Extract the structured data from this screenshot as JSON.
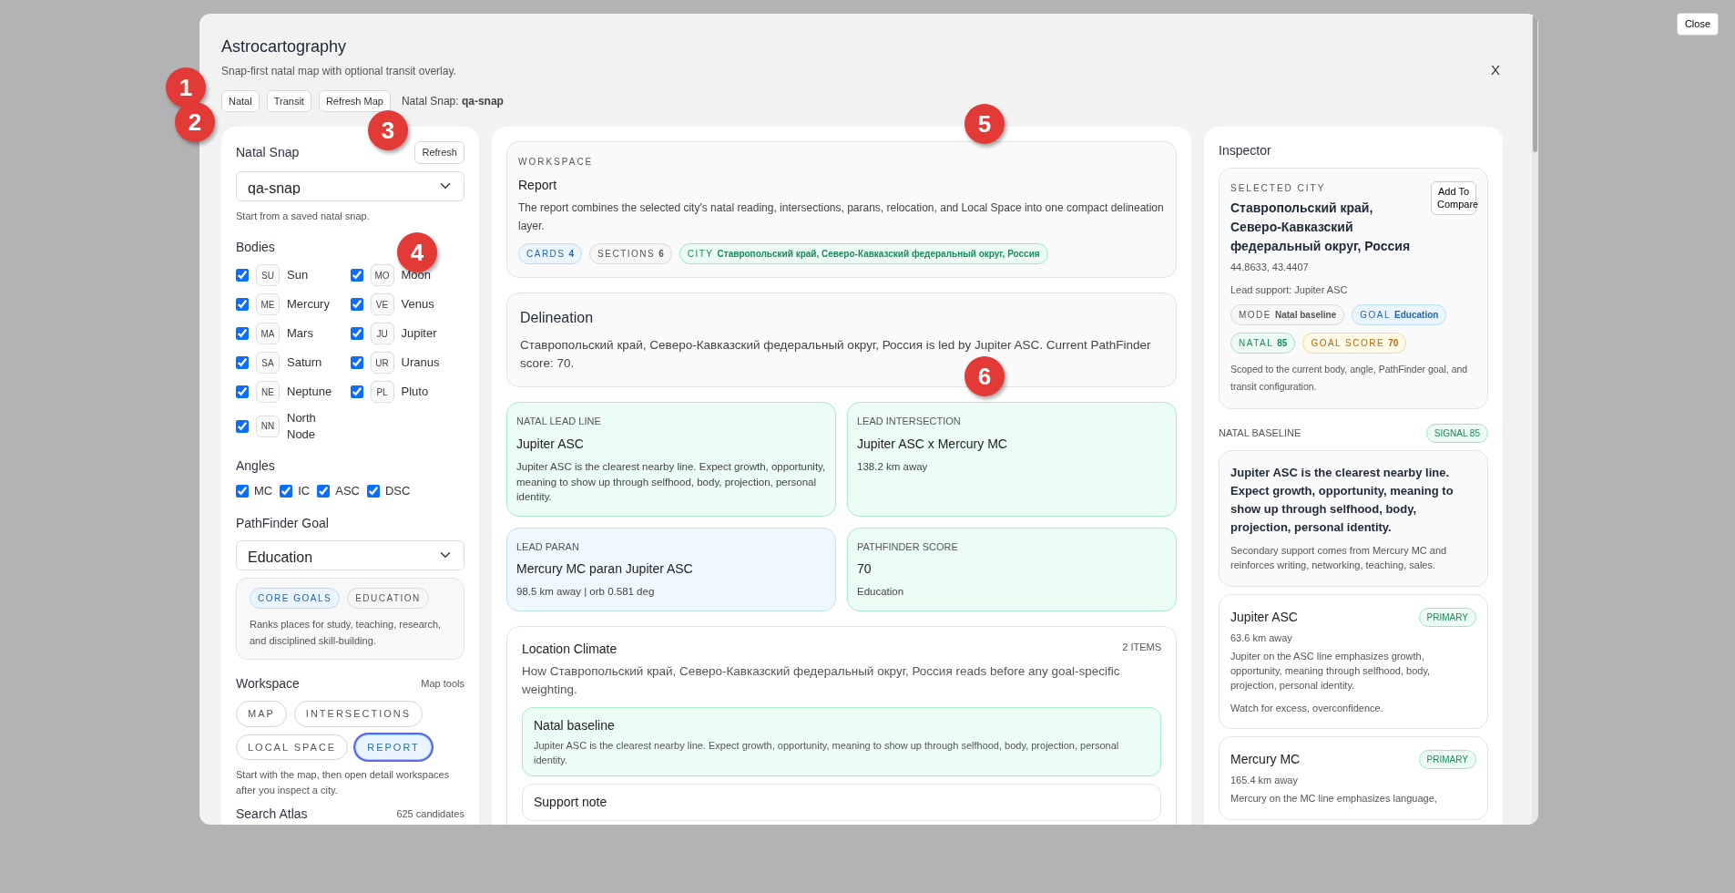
{
  "page": {
    "close_button": "Close"
  },
  "modal": {
    "title": "Astrocartography",
    "subtitle": "Snap-first natal map with optional transit overlay.",
    "close": "X",
    "mode_buttons": [
      "Natal",
      "Transit",
      "Refresh Map"
    ],
    "snap_label": "Natal Snap:",
    "snap_value": "qa-snap"
  },
  "markers": [
    "1",
    "2",
    "3",
    "4",
    "5",
    "6"
  ],
  "left": {
    "snap_title": "Natal Snap",
    "refresh": "Refresh",
    "snap_select": "qa-snap",
    "snap_help": "Start from a saved natal snap.",
    "bodies_title": "Bodies",
    "bodies": [
      {
        "code": "SU",
        "name": "Sun",
        "checked": true
      },
      {
        "code": "MO",
        "name": "Moon",
        "checked": true
      },
      {
        "code": "ME",
        "name": "Mercury",
        "checked": true
      },
      {
        "code": "VE",
        "name": "Venus",
        "checked": true
      },
      {
        "code": "MA",
        "name": "Mars",
        "checked": true
      },
      {
        "code": "JU",
        "name": "Jupiter",
        "checked": true
      },
      {
        "code": "SA",
        "name": "Saturn",
        "checked": true
      },
      {
        "code": "UR",
        "name": "Uranus",
        "checked": true
      },
      {
        "code": "NE",
        "name": "Neptune",
        "checked": true
      },
      {
        "code": "PL",
        "name": "Pluto",
        "checked": true
      },
      {
        "code": "NN",
        "name": "North Node",
        "checked": true
      }
    ],
    "angles_title": "Angles",
    "angles": [
      {
        "name": "MC",
        "checked": true
      },
      {
        "name": "IC",
        "checked": true
      },
      {
        "name": "ASC",
        "checked": true
      },
      {
        "name": "DSC",
        "checked": true
      }
    ],
    "goal_title": "PathFinder Goal",
    "goal_select": "Education",
    "goal_tags": [
      {
        "text": "CORE GOALS",
        "kind": "info"
      },
      {
        "text": "EDUCATION",
        "kind": "neutral"
      }
    ],
    "goal_text": "Ranks places for study, teaching, research, and disciplined skill-building.",
    "workspace_title": "Workspace",
    "workspace_link": "Map tools",
    "workspace_tabs": [
      {
        "label": "MAP",
        "selected": false
      },
      {
        "label": "INTERSECTIONS",
        "selected": false
      },
      {
        "label": "LOCAL SPACE",
        "selected": false
      },
      {
        "label": "REPORT",
        "selected": true
      }
    ],
    "workspace_help": "Start with the map, then open detail workspaces after you inspect a city.",
    "atlas_title": "Search Atlas",
    "atlas_count": "625 candidates"
  },
  "center": {
    "workspace": {
      "eyebrow": "WORKSPACE",
      "title": "Report",
      "text": "The report combines the selected city's natal reading, intersections, parans, relocation, and Local Space into one compact delineation layer.",
      "chips": [
        {
          "label": "CARDS",
          "value": "4",
          "kind": "info"
        },
        {
          "label": "SECTIONS",
          "value": "6",
          "kind": "neutral"
        },
        {
          "label": "CITY",
          "value": "Ставропольский край, Северо-Кавказский федеральный округ, Россия",
          "kind": "success"
        }
      ]
    },
    "delineation": {
      "title": "Delineation",
      "text": "Ставропольский край, Северо-Кавказский федеральный округ, Россия is led by Jupiter ASC. Current PathFinder score: 70."
    },
    "summary_cards": [
      {
        "label": "NATAL LEAD LINE",
        "title": "Jupiter ASC",
        "text": "Jupiter ASC is the clearest nearby line. Expect growth, opportunity, meaning to show up through selfhood, body, projection, personal identity.",
        "kind": "success"
      },
      {
        "label": "LEAD INTERSECTION",
        "title": "Jupiter ASC x Mercury MC",
        "text": "138.2 km away",
        "kind": "success"
      },
      {
        "label": "LEAD PARAN",
        "title": "Mercury MC paran Jupiter ASC",
        "text": "98.5 km away | orb 0.581 deg",
        "kind": "info"
      },
      {
        "label": "PATHFINDER SCORE",
        "title": "70",
        "text": "Education",
        "kind": "success"
      }
    ],
    "climate": {
      "title": "Location Climate",
      "count": "2 ITEMS",
      "text": "How Ставропольский край, Северо-Кавказский федеральный округ, Россия reads before any goal-specific weighting.",
      "items": [
        {
          "title": "Natal baseline",
          "text": "Jupiter ASC is the clearest nearby line. Expect growth, opportunity, meaning to show up through selfhood, body, projection, personal identity.",
          "kind": "success"
        },
        {
          "title": "Support note",
          "kind": "neutral"
        }
      ]
    }
  },
  "inspector": {
    "title": "Inspector",
    "city": {
      "eyebrow": "SELECTED CITY",
      "name": "Ставропольский край, Северо-Кавказский федеральный округ, Россия",
      "compare": "Add To Compare",
      "coords": "44.8633, 43.4407",
      "lead": "Lead support: Jupiter ASC",
      "chips": [
        {
          "label": "MODE",
          "value": "Natal baseline",
          "kind": "neutral"
        },
        {
          "label": "GOAL",
          "value": "Education",
          "kind": "info"
        },
        {
          "label": "NATAL",
          "value": "85",
          "kind": "success"
        },
        {
          "label": "GOAL SCORE",
          "value": "70",
          "kind": "warning"
        }
      ],
      "note": "Scoped to the current body, angle, PathFinder goal, and transit configuration."
    },
    "baseline_label": "NATAL BASELINE",
    "baseline_signal": "SIGNAL 85",
    "baseline": {
      "headline": "Jupiter ASC is the clearest nearby line. Expect growth, opportunity, meaning to show up through selfhood, body, projection, personal identity.",
      "text": "Secondary support comes from Mercury MC and reinforces writing, networking, teaching, sales."
    },
    "lines": [
      {
        "title": "Jupiter ASC",
        "badge": "PRIMARY",
        "distance": "63.6 km away",
        "text": "Jupiter on the ASC line emphasizes growth, opportunity, meaning through selfhood, body, projection, personal identity.",
        "warning": "Watch for excess, overconfidence."
      },
      {
        "title": "Mercury MC",
        "badge": "PRIMARY",
        "distance": "165.4 km away",
        "text": "Mercury on the MC line emphasizes language,"
      }
    ]
  }
}
